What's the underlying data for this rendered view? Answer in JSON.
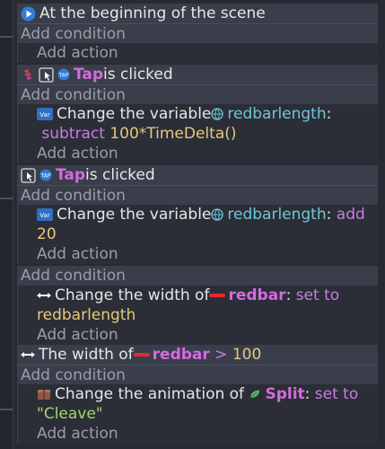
{
  "events": [
    {
      "condition": {
        "text": "At the beginning of the scene"
      },
      "add_condition": "Add condition",
      "add_action": "Add action"
    },
    {
      "condition": {
        "object": "Tap",
        "text": " is clicked"
      },
      "add_condition": "Add condition",
      "action": {
        "prefix": "Change the variable ",
        "variable": "redbarlength",
        "colon": ":",
        "operation": " subtract ",
        "value": "100*TimeDelta()"
      },
      "add_action": "Add action"
    },
    {
      "condition": {
        "object": "Tap",
        "text": " is clicked"
      },
      "add_condition": "Add condition",
      "action": {
        "prefix": "Change the variable ",
        "variable": "redbarlength",
        "colon": ":",
        "operation": " add ",
        "value": "20"
      },
      "add_action": "Add action"
    },
    {
      "add_condition": "Add condition",
      "action": {
        "prefix": "Change the width of ",
        "object": "redbar",
        "colon": ":",
        "operation": " set to ",
        "value": "redbarlength"
      },
      "add_action": "Add action"
    },
    {
      "condition": {
        "prefix": "The width of ",
        "object": "redbar",
        "operator": " > ",
        "value": "100"
      },
      "add_condition": "Add condition",
      "action": {
        "prefix": "Change the animation of ",
        "object": "Split",
        "colon": ":",
        "operation": " set to ",
        "value": "\"Cleave\""
      },
      "add_action": "Add action"
    }
  ],
  "colors": {
    "background": "#272a33",
    "condition_bg": "#3a3e4a",
    "object_name": "#d36bdf",
    "variable": "#6fc6d8",
    "number": "#e8c97a",
    "string": "#9ed86a",
    "redbar": "#e32a2a"
  },
  "icons": [
    "play-icon",
    "cursor-click-icon",
    "tap-object-icon",
    "variable-icon",
    "global-variable-icon",
    "resize-arrows-icon",
    "animation-box-icon",
    "leaf-sprite-icon",
    "redbar-swatch-icon"
  ]
}
